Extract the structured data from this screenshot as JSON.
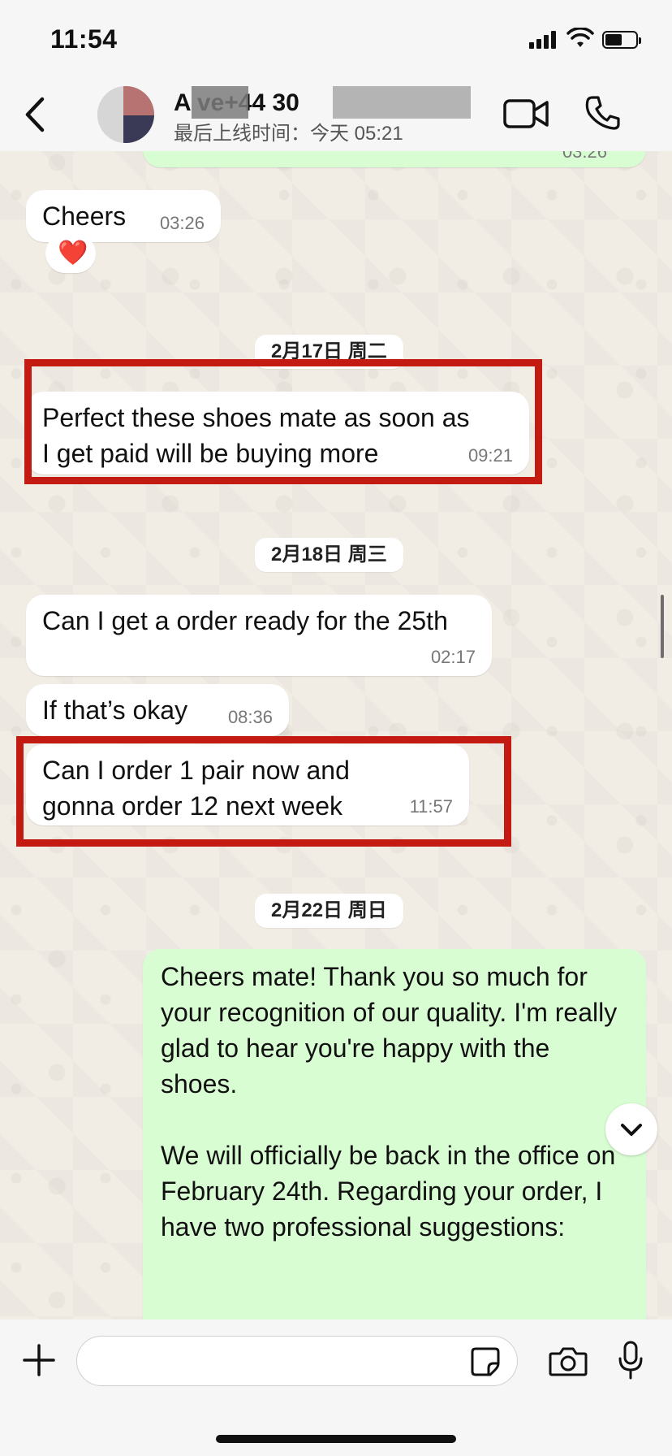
{
  "status_bar": {
    "time": "11:54",
    "battery_level": 0.55
  },
  "header": {
    "contact_name": "A     ve+44               30",
    "last_seen": "最后上线时间：今天 05:21",
    "icons": {
      "back": "chevron-left-icon",
      "video": "video-camera-icon",
      "call": "phone-icon"
    }
  },
  "chat": {
    "top_partial_time": "03:26",
    "messages": [
      {
        "text": "Cheers",
        "time": "03:26",
        "direction": "in",
        "reaction": "❤️"
      },
      {
        "date_divider": "2月17日 周二"
      },
      {
        "text": "Perfect these shoes mate as soon as I get paid will be buying more",
        "time": "09:21",
        "direction": "in",
        "highlighted": true
      },
      {
        "date_divider": "2月18日 周三"
      },
      {
        "text": "Can I get a order ready for the 25th",
        "time": "02:17",
        "direction": "in"
      },
      {
        "text": "If that’s okay",
        "time": "08:36",
        "direction": "in"
      },
      {
        "text": "Can I order 1 pair now and gonna order 12 next week",
        "time": "11:57",
        "direction": "in",
        "highlighted": true
      },
      {
        "date_divider": "2月22日 周日"
      },
      {
        "text": "Cheers mate! Thank you so much for your recognition of our quality. I'm really glad to hear you're happy with the shoes.",
        "direction": "out"
      },
      {
        "text": "We will officially be back in the office on February 24th. Regarding your order, I have two professional suggestions:",
        "direction": "out"
      }
    ]
  },
  "input_bar": {
    "placeholder": "",
    "value": ""
  },
  "colors": {
    "incoming": "#ffffff",
    "outgoing": "#d9fdd3",
    "highlight": "#c31a12",
    "wallpaper": "#efeae2"
  }
}
